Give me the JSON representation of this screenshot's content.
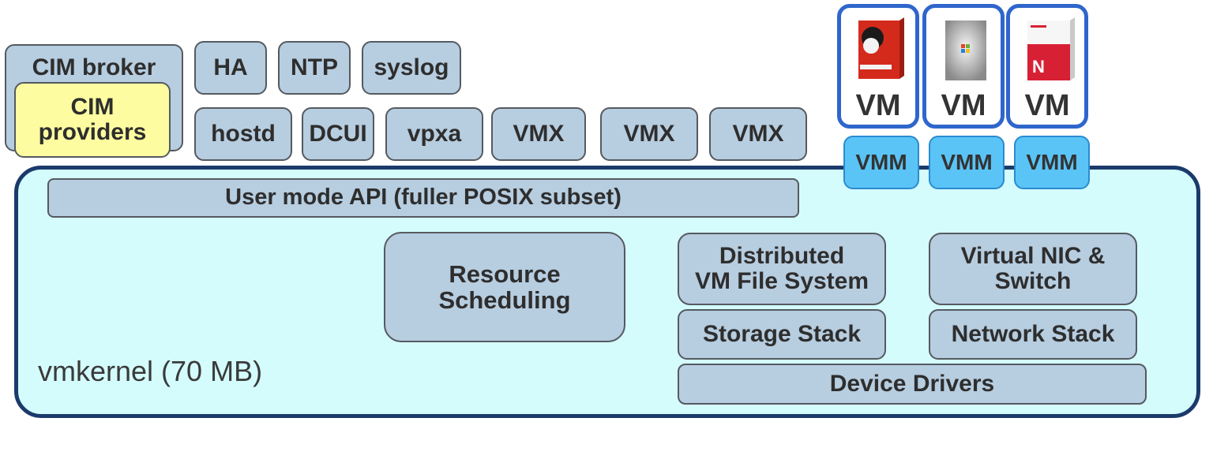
{
  "diagram": {
    "cim": {
      "broker": "CIM broker",
      "providers": [
        "CIM",
        "providers"
      ]
    },
    "user_services_top": [
      "HA",
      "NTP",
      "syslog"
    ],
    "user_services_bottom": [
      "hostd",
      "DCUI",
      "vpxa",
      "VMX",
      "VMX",
      "VMX"
    ],
    "vms": [
      {
        "label": "VM",
        "image": "redhat-box-icon"
      },
      {
        "label": "VM",
        "image": "windows-box-icon"
      },
      {
        "label": "VM",
        "image": "netware-box-icon"
      }
    ],
    "vmm_label": "VMM",
    "kernel": {
      "label": "vmkernel (70 MB)",
      "user_api": "User mode API (fuller POSIX subset)",
      "resource_scheduling": [
        "Resource",
        "Scheduling"
      ],
      "dvmfs": [
        "Distributed",
        "VM File System"
      ],
      "vnic": [
        "Virtual NIC &",
        "Switch"
      ],
      "storage_stack": "Storage Stack",
      "network_stack": "Network Stack",
      "device_drivers": "Device Drivers"
    },
    "colors": {
      "component_fill": "#b7cde0",
      "cim_providers_fill": "#fdfca0",
      "kernel_fill": "#d4fcfd",
      "kernel_border": "#1b3a6b",
      "vm_border": "#2f66cc",
      "vmm_fill": "#5ac4f6"
    }
  }
}
